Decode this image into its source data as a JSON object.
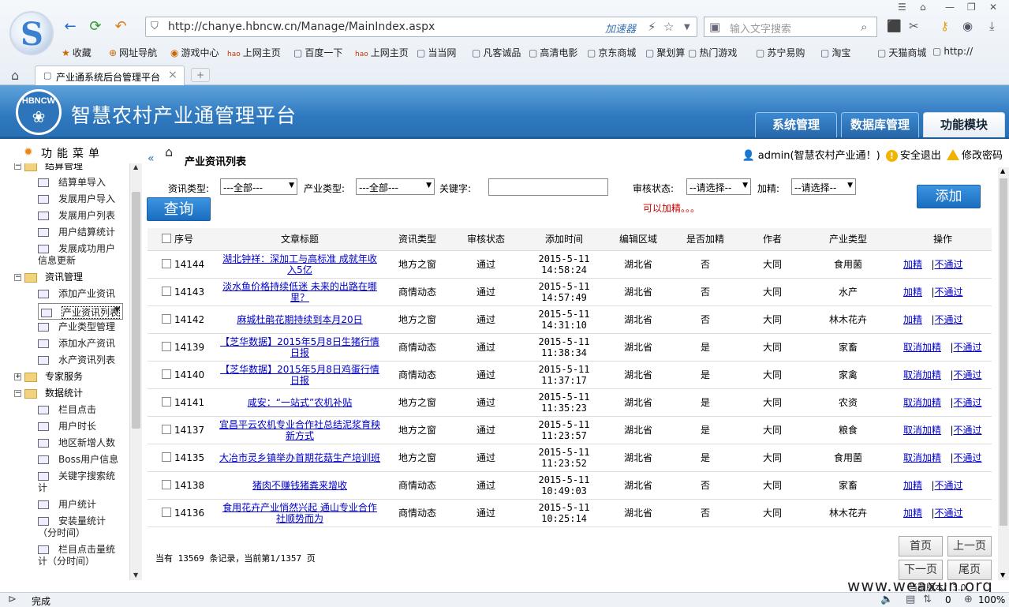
{
  "browser": {
    "url": "http://chanye.hbncw.cn/Manage/MainIndex.aspx",
    "accelerator": "加速器",
    "search_placeholder": "输入文字搜索",
    "bookmarks": [
      "收藏",
      "网址导航",
      "游戏中心",
      "上网主页",
      "百度一下",
      "上网主页",
      "当当网",
      "凡客诚品",
      "高清电影",
      "京东商城",
      "聚划算",
      "热门游戏",
      "苏宁易购",
      "淘宝",
      "天猫商城",
      "http://"
    ],
    "tab_title": "产业通系统后台管理平台",
    "status": "完成",
    "zoom": "100%",
    "status_count": "0"
  },
  "app": {
    "title": "智慧农村产业通管理平台",
    "logo_text": "HBNCW",
    "tabs": [
      "系统管理",
      "数据库管理",
      "功能模块"
    ],
    "active_tab": "功能模块"
  },
  "left": {
    "title": "功能菜单",
    "items": [
      {
        "label": "结算管理",
        "type": "group"
      },
      {
        "label": "结算单导入",
        "type": "leaf"
      },
      {
        "label": "发展用户导入",
        "type": "leaf"
      },
      {
        "label": "发展用户列表",
        "type": "leaf"
      },
      {
        "label": "用户结算统计",
        "type": "leaf"
      },
      {
        "label": "发展成功用户",
        "label2": "信息更新",
        "type": "leaf"
      },
      {
        "label": "资讯管理",
        "type": "group"
      },
      {
        "label": "添加产业资讯",
        "type": "leaf"
      },
      {
        "label": "产业资讯列表",
        "type": "leaf"
      },
      {
        "label": "产业类型管理",
        "type": "leaf"
      },
      {
        "label": "添加水产资讯",
        "type": "leaf"
      },
      {
        "label": "水产资讯列表",
        "type": "leaf"
      },
      {
        "label": "专家服务",
        "type": "group"
      },
      {
        "label": "数据统计",
        "type": "group"
      },
      {
        "label": "栏目点击",
        "type": "leaf"
      },
      {
        "label": "用户时长",
        "type": "leaf"
      },
      {
        "label": "地区新增人数",
        "type": "leaf"
      },
      {
        "label": "Boss用户信息",
        "type": "leaf"
      },
      {
        "label": "关键字搜索统",
        "label2": "计",
        "type": "leaf"
      },
      {
        "label": "用户统计",
        "type": "leaf"
      },
      {
        "label": "安装量统计",
        "label2": "（分时间）",
        "type": "leaf"
      },
      {
        "label": "栏目点击量统",
        "label2": "计（分时间）",
        "type": "leaf"
      }
    ]
  },
  "main": {
    "crumb": "产业资讯列表",
    "user": "admin(智慧农村产业通！)",
    "logout": "安全退出",
    "change_pwd": "修改密码",
    "filters": {
      "type_label": "资讯类型:",
      "type_value": "---全部---",
      "industry_label": "产业类型:",
      "industry_value": "---全部---",
      "keyword_label": "关键字:",
      "keyword_value": "",
      "audit_label": "审核状态:",
      "audit_value": "--请选择--",
      "jing_label": "加精:",
      "jing_value": "--请选择--",
      "note": "可以加精。。。"
    },
    "query_btn": "查询",
    "add_btn": "添加",
    "columns": [
      "序号",
      "文章标题",
      "资讯类型",
      "审核状态",
      "添加时间",
      "编辑区域",
      "是否加精",
      "作者",
      "产业类型",
      "操作"
    ],
    "rows": [
      {
        "id": "14144",
        "title": "湖北钟祥：深加工与高标准 成就年收入5亿",
        "type": "地方之窗",
        "audit": "通过",
        "date": "2015-5-11",
        "time": "14:58:24",
        "area": "湖北省",
        "jing": "否",
        "author": "大同",
        "industry": "食用菌",
        "op1": "加精",
        "op2": "不通过"
      },
      {
        "id": "14143",
        "title": "淡水鱼价格持续低迷 未来的出路在哪里？",
        "type": "商情动态",
        "audit": "通过",
        "date": "2015-5-11",
        "time": "14:57:49",
        "area": "湖北省",
        "jing": "否",
        "author": "大同",
        "industry": "水产",
        "op1": "加精",
        "op2": "不通过"
      },
      {
        "id": "14142",
        "title": "麻城杜鹃花期持续到本月20日",
        "type": "地方之窗",
        "audit": "通过",
        "date": "2015-5-11",
        "time": "14:31:10",
        "area": "湖北省",
        "jing": "否",
        "author": "大同",
        "industry": "林木花卉",
        "op1": "加精",
        "op2": "不通过"
      },
      {
        "id": "14139",
        "title": "【芝华数据】2015年5月8日生猪行情日报",
        "type": "商情动态",
        "audit": "通过",
        "date": "2015-5-11",
        "time": "11:38:34",
        "area": "湖北省",
        "jing": "是",
        "author": "大同",
        "industry": "家畜",
        "op1": "取消加精",
        "op2": "不通过"
      },
      {
        "id": "14140",
        "title": "【芝华数据】2015年5月8日鸡蛋行情日报",
        "type": "商情动态",
        "audit": "通过",
        "date": "2015-5-11",
        "time": "11:37:17",
        "area": "湖北省",
        "jing": "是",
        "author": "大同",
        "industry": "家禽",
        "op1": "取消加精",
        "op2": "不通过"
      },
      {
        "id": "14141",
        "title": "咸安：“一站式”农机补贴",
        "type": "地方之窗",
        "audit": "通过",
        "date": "2015-5-11",
        "time": "11:35:23",
        "area": "湖北省",
        "jing": "是",
        "author": "大同",
        "industry": "农资",
        "op1": "取消加精",
        "op2": "不通过"
      },
      {
        "id": "14137",
        "title": "宜昌平云农机专业合作社总结泥浆育秧新方式",
        "type": "地方之窗",
        "audit": "通过",
        "date": "2015-5-11",
        "time": "11:23:57",
        "area": "湖北省",
        "jing": "是",
        "author": "大同",
        "industry": "粮食",
        "op1": "取消加精",
        "op2": "不通过"
      },
      {
        "id": "14135",
        "title": "大冶市灵乡镇举办首期花菇生产培训班",
        "type": "地方之窗",
        "audit": "通过",
        "date": "2015-5-11",
        "time": "11:23:52",
        "area": "湖北省",
        "jing": "是",
        "author": "大同",
        "industry": "食用菌",
        "op1": "取消加精",
        "op2": "不通过"
      },
      {
        "id": "14138",
        "title": "猪肉不赚钱猪粪来增收",
        "type": "商情动态",
        "audit": "通过",
        "date": "2015-5-11",
        "time": "10:49:03",
        "area": "湖北省",
        "jing": "否",
        "author": "大同",
        "industry": "家畜",
        "op1": "加精",
        "op2": "不通过"
      },
      {
        "id": "14136",
        "title": "食用花卉产业悄然兴起 通山专业合作社顺势而为",
        "type": "商情动态",
        "audit": "通过",
        "date": "2015-5-11",
        "time": "10:25:14",
        "area": "湖北省",
        "jing": "否",
        "author": "大同",
        "industry": "林木花卉",
        "op1": "加精",
        "op2": "不通过"
      }
    ],
    "pager_text": "当有 13569 条记录，当前第1/1357 页",
    "first": "首页",
    "prev": "上一页",
    "next": "下一页",
    "last": "尾页"
  },
  "watermark": "www.weaxun.org",
  "watermark2": "当前版本：3.0"
}
